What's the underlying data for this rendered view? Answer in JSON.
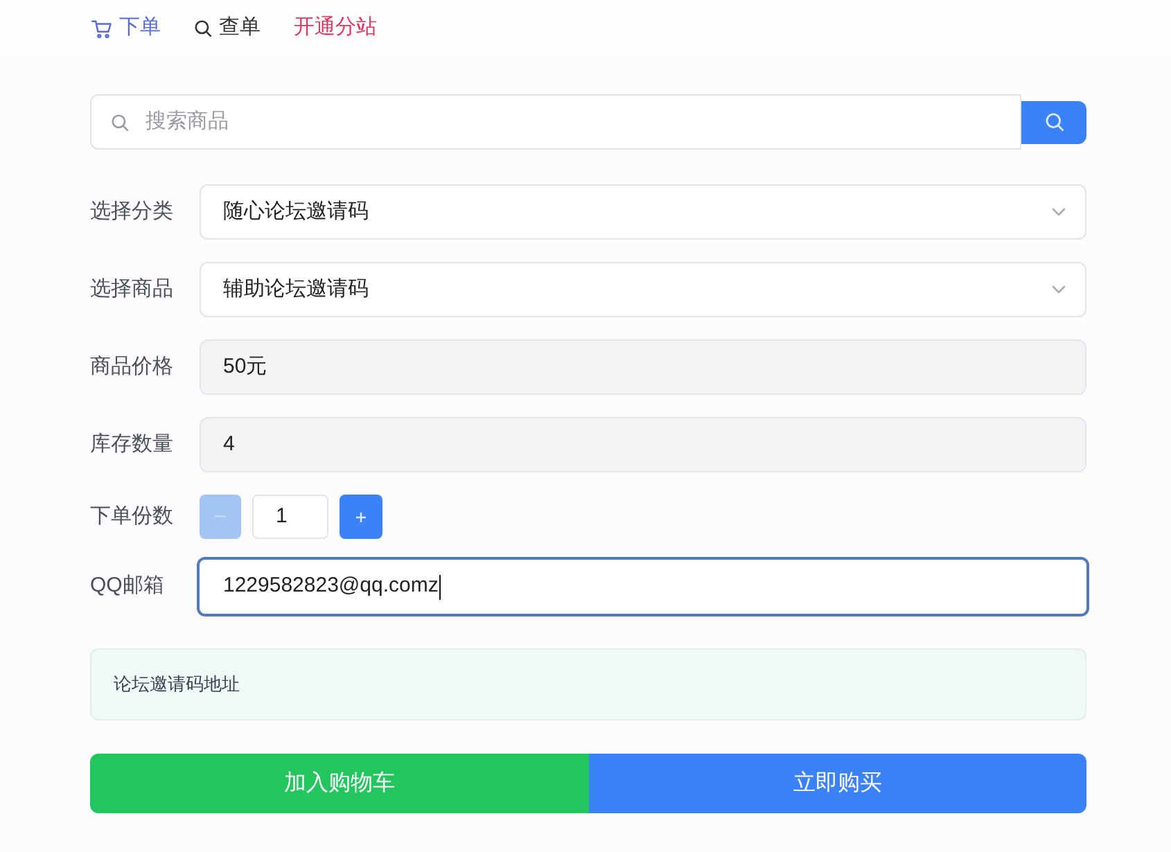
{
  "nav": {
    "items": [
      {
        "kind": "order",
        "label": "下单",
        "selected": true
      },
      {
        "kind": "query",
        "label": "查单",
        "selected": false
      },
      {
        "kind": "highlight",
        "label": "开通分站",
        "selected": false
      }
    ]
  },
  "search": {
    "placeholder": "搜索商品"
  },
  "form": {
    "fields": [
      {
        "kind": "select",
        "label": "选择分类",
        "value": "随心论坛邀请码"
      },
      {
        "kind": "select",
        "label": "选择商品",
        "value": "辅助论坛邀请码"
      },
      {
        "kind": "readonly",
        "label": "商品价格",
        "value": "50元"
      },
      {
        "kind": "readonly",
        "label": "库存数量",
        "value": "4"
      },
      {
        "kind": "quantity",
        "label": "下单份数",
        "value": "1",
        "decrement_disabled": true,
        "increment_disabled": false
      },
      {
        "kind": "input",
        "label": "QQ邮箱",
        "value": "1229582823@qq.comz",
        "focused": true
      }
    ]
  },
  "notice": {
    "text": "论坛邀请码地址"
  },
  "actions": [
    {
      "kind": "cart",
      "label": "加入购物车"
    },
    {
      "kind": "buy",
      "label": "立即购买"
    }
  ]
}
